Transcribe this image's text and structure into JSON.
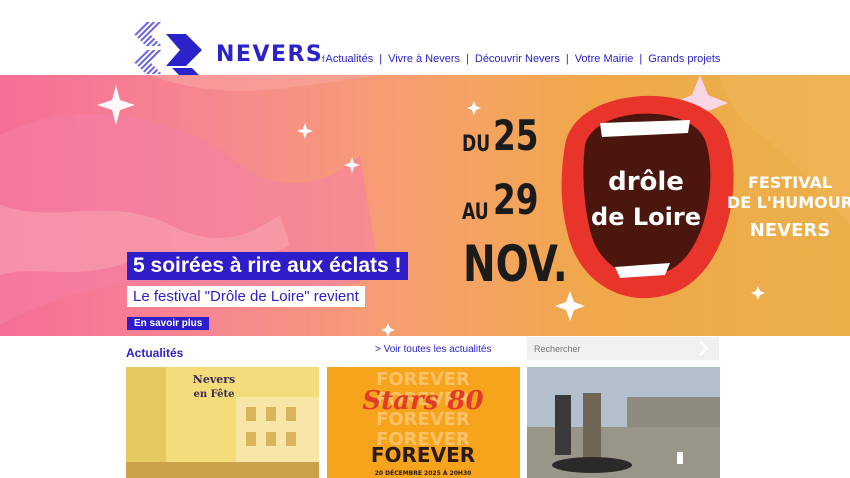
{
  "header": {
    "brand": "NEVERS",
    "facebook_glyph": "f",
    "nav": [
      "Actualités",
      "Vivre à Nevers",
      "Découvrir Nevers",
      "Votre Mairie",
      "Grands projets"
    ],
    "separator": "|"
  },
  "hero": {
    "headline": "5 soirées à rire aux éclats !",
    "subtitle": "Le festival \"Drôle de Loire\" revient",
    "button": "En savoir plus",
    "date_du": "DU",
    "date_day1": "25",
    "date_au": "AU",
    "date_day2": "29",
    "date_month": "NOV.",
    "logo_line1": "drôle",
    "logo_line2": "de Loire",
    "festival_lines": [
      "FESTIVAL",
      "DE L'HUMOUR",
      "NEVERS"
    ]
  },
  "news": {
    "title": "Actualités",
    "see_all": "> Voir toutes les actualités",
    "search_placeholder": "Rechercher",
    "cards": [
      {
        "top_text": "Nevers",
        "sub_text": "en Fête"
      },
      {
        "top_text": "Stars 80",
        "main_text": "FOREVER",
        "repeat": "FOREVER",
        "caption": "20 DÉCEMBRE 2025 À 20H30"
      },
      {
        "kind": "photo"
      }
    ]
  },
  "colors": {
    "brand": "#2b22c9",
    "hero_button": "#2f1dc9"
  }
}
